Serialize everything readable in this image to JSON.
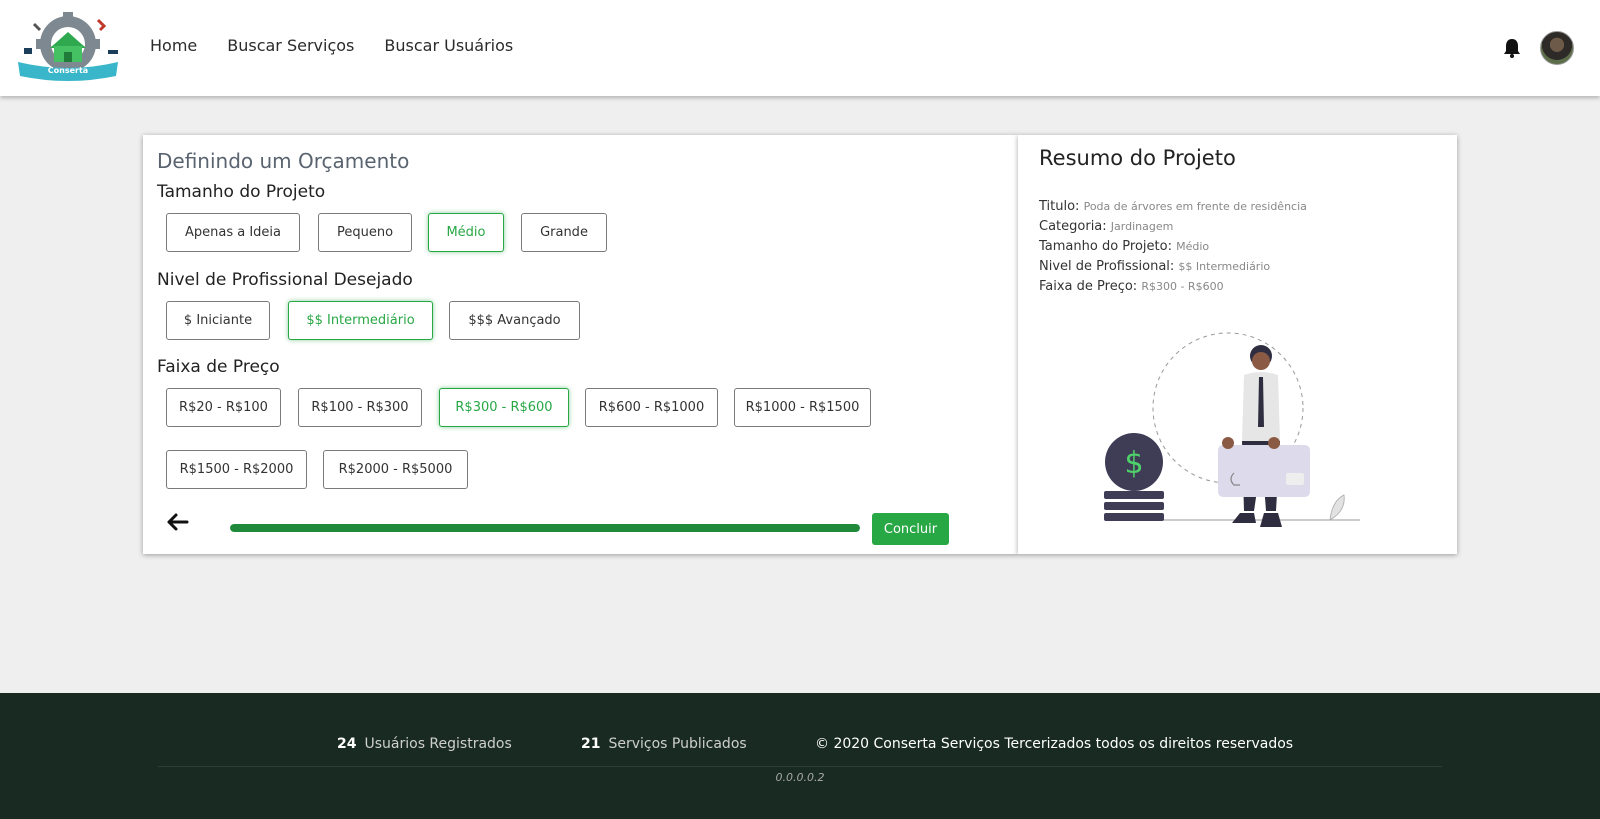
{
  "header": {
    "logo_text": "Conserta",
    "nav": [
      "Home",
      "Buscar Serviços",
      "Buscar Usuários"
    ]
  },
  "orcamento": {
    "title": "Definindo um Orçamento",
    "tamanho": {
      "label": "Tamanho do Projeto",
      "options": [
        "Apenas a Ideia",
        "Pequeno",
        "Médio",
        "Grande"
      ],
      "selected": "Médio"
    },
    "nivel": {
      "label": "Nivel de Profissional Desejado",
      "options": [
        "$ Iniciante",
        "$$ Intermediário",
        "$$$ Avançado"
      ],
      "selected": "$$ Intermediário"
    },
    "faixa": {
      "label": "Faixa de Preço",
      "options": [
        "R$20 - R$100",
        "R$100 - R$300",
        "R$300 - R$600",
        "R$600 - R$1000",
        "R$1000 - R$1500",
        "R$1500 - R$2000",
        "R$2000 - R$5000"
      ],
      "selected": "R$300 - R$600"
    },
    "progress": 1.0,
    "submit_label": "Concluir"
  },
  "resumo": {
    "title": "Resumo do Projeto",
    "titulo_label": "Titulo:",
    "titulo_value": "Poda de árvores em frente de residência",
    "categoria_label": "Categoria:",
    "categoria_value": "Jardinagem",
    "tamanho_label": "Tamanho do Projeto:",
    "tamanho_value": "Médio",
    "nivel_label": "Nivel de Profissional:",
    "nivel_value": "$$ Intermediário",
    "faixa_label": "Faixa de Preço:",
    "faixa_value": "R$300 - R$600"
  },
  "footer": {
    "usuarios_count": "24",
    "usuarios_label": "Usuários Registrados",
    "servicos_count": "21",
    "servicos_label": "Serviços Publicados",
    "copyright": "© 2020 Conserta Serviços Tercerizados todos os direitos reservados",
    "version": "0.0.0.0.2"
  },
  "colors": {
    "accent": "#28a745",
    "progress": "#1e8a3a",
    "footer_bg": "#182a22"
  }
}
